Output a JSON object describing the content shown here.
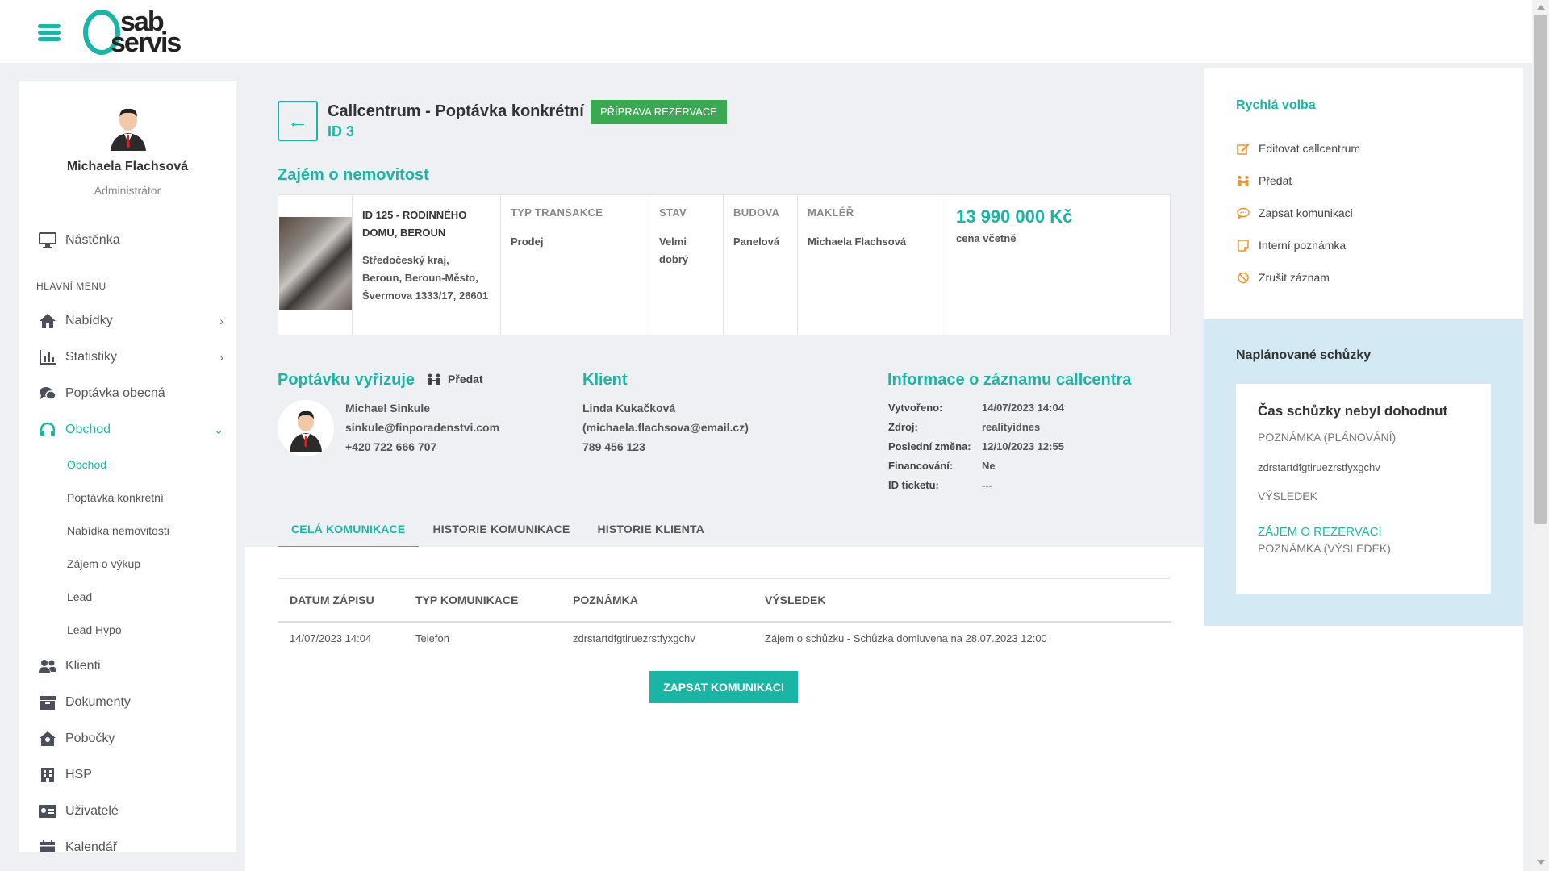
{
  "brand": {
    "logo_top": "sab",
    "logo_bottom": "servis"
  },
  "colors": {
    "accent": "#1bb5a5",
    "badge": "#3aaa52",
    "quick_icon": "#f0962e",
    "meet_bg": "#d3e9f4"
  },
  "user": {
    "name": "Michaela Flachsová",
    "role": "Administrátor"
  },
  "sidebar": {
    "dashboard": "Nástěnka",
    "menu_heading": "HLAVNÍ MENU",
    "items": [
      {
        "label": "Nabídky",
        "icon": "home-icon"
      },
      {
        "label": "Statistiky",
        "icon": "bar-chart-icon"
      },
      {
        "label": "Poptávka obecná",
        "icon": "chat-icon"
      },
      {
        "label": "Obchod",
        "icon": "headset-icon"
      }
    ],
    "sub_items": [
      "Obchod",
      "Poptávka konkrétní",
      "Nabídka nemovitosti",
      "Zájem o výkup",
      "Lead",
      "Lead Hypo"
    ],
    "items_bottom": [
      {
        "label": "Klienti",
        "icon": "users-icon"
      },
      {
        "label": "Dokumenty",
        "icon": "archive-icon"
      },
      {
        "label": "Pobočky",
        "icon": "branch-icon"
      },
      {
        "label": "HSP",
        "icon": "building-icon"
      },
      {
        "label": "Uživatelé",
        "icon": "id-card-icon"
      },
      {
        "label": "Kalendář",
        "icon": "calendar-icon"
      }
    ]
  },
  "header": {
    "title": "Callcentrum - Poptávka konkrétní",
    "badge": "PŘÍPRAVA REZERVACE",
    "id": "ID 3"
  },
  "property": {
    "section_title": "Zajém o nemovitost",
    "name": "ID 125 - RODINNÉHO DOMU, BEROUN",
    "address": "Středočeský kraj, Beroun, Beroun-Město, Švermova 1333/17, 26601",
    "columns": [
      {
        "label": "TYP TRANSAKCE",
        "value": "Prodej"
      },
      {
        "label": "STAV",
        "value": "Velmi dobrý"
      },
      {
        "label": "BUDOVA",
        "value": "Panelová"
      },
      {
        "label": "MAKLÉŘ",
        "value": "Michaela Flachsová"
      }
    ],
    "price": "13 990 000 Kč",
    "price_note": "cena včetně"
  },
  "handler": {
    "title": "Poptávku vyřizuje",
    "predat": "Předat",
    "name": "Michael Sinkule",
    "email": "sinkule@finporadenstvi.com",
    "phone": "+420 722 666 707"
  },
  "client": {
    "title": "Klient",
    "name": "Linda Kukačková",
    "email": "(michaela.flachsova@email.cz)",
    "phone": "789 456 123"
  },
  "record": {
    "title": "Informace o záznamu callcentra",
    "rows": [
      {
        "k": "Vytvořeno:",
        "v": "14/07/2023 14:04"
      },
      {
        "k": "Zdroj:",
        "v": "realityidnes"
      },
      {
        "k": "Poslední změna:",
        "v": "12/10/2023 12:55"
      },
      {
        "k": "Financování:",
        "v": "Ne"
      },
      {
        "k": "ID ticketu:",
        "v": "---"
      }
    ]
  },
  "tabs": [
    "CELÁ KOMUNIKACE",
    "HISTORIE KOMUNIKACE",
    "HISTORIE KLIENTA"
  ],
  "table": {
    "headers": [
      "DATUM ZÁPISU",
      "TYP KOMUNIKACE",
      "POZNÁMKA",
      "VÝSLEDEK"
    ],
    "rows": [
      [
        "14/07/2023 14:04",
        "Telefon",
        "zdrstartdfgtiruezrstfyxgchv",
        "Zájem o schůzku - Schůzka domluvena na 28.07.2023 12:00"
      ]
    ]
  },
  "zapsat_button": "ZAPSAT KOMUNIKACI",
  "quick": {
    "title": "Rychlá volba",
    "items": [
      {
        "label": "Editovat callcentrum",
        "icon": "edit-icon"
      },
      {
        "label": "Předat",
        "icon": "handover-icon"
      },
      {
        "label": "Zapsat komunikaci",
        "icon": "comment-icon"
      },
      {
        "label": "Interní poznámka",
        "icon": "note-icon"
      },
      {
        "label": "Zrušit záznam",
        "icon": "ban-icon"
      }
    ]
  },
  "meetings": {
    "title": "Naplánované schůzky",
    "heading": "Čas schůzky nebyl dohodnut",
    "note_label": "POZNÁMKA (PLÁNOVÁNÍ)",
    "note_text": "zdrstartdfgtiruezrstfyxgchv",
    "result_label": "VÝSLEDEK",
    "result_value": "ZÁJEM O REZERVACI",
    "result_note_label": "POZNÁMKA (VÝSLEDEK)"
  }
}
